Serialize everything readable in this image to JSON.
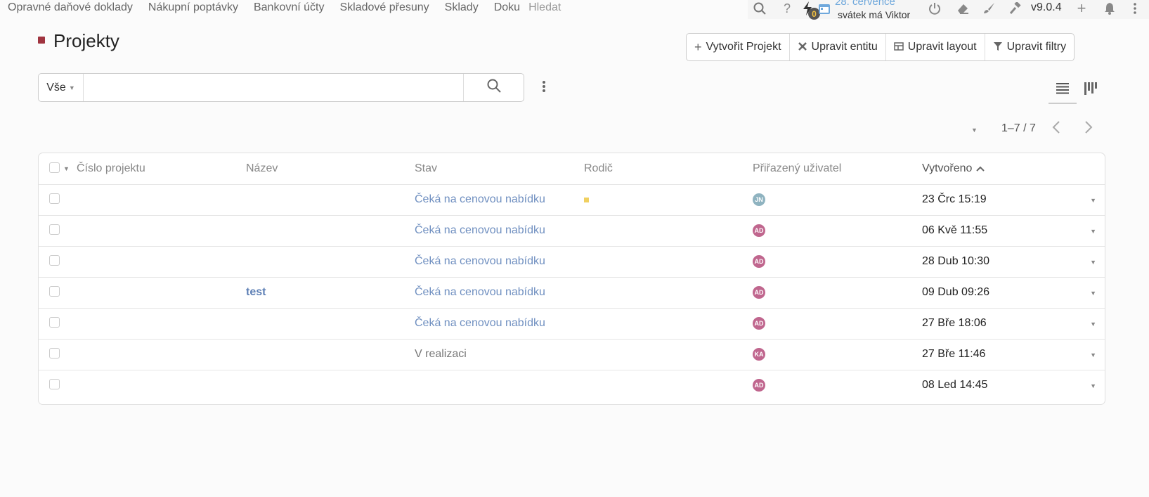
{
  "nav": {
    "links": [
      "Opravné daňové doklady",
      "Nákupní poptávky",
      "Bankovní účty",
      "Skladové přesuny",
      "Sklady",
      "Doku"
    ],
    "search_placeholder": "Hledat",
    "notification_count": "0",
    "date": "28. července",
    "holiday": "svátek má Viktor",
    "version": "v9.0.4"
  },
  "page": {
    "title": "Projekty",
    "accent_color": "#a0343f"
  },
  "actions": {
    "create": "Vytvořit Projekt",
    "edit_entity": "Upravit entitu",
    "edit_layout": "Upravit layout",
    "edit_filters": "Upravit filtry"
  },
  "search": {
    "scope": "Vše",
    "value": ""
  },
  "pagination": {
    "range": "1–7 / 7"
  },
  "table": {
    "headers": {
      "number": "Číslo projektu",
      "name": "Název",
      "status": "Stav",
      "parent": "Rodič",
      "assigned": "Přiřazený uživatel",
      "created": "Vytvořeno"
    },
    "rows": [
      {
        "name": "",
        "status": "Čeká na cenovou nabídku",
        "avatar": "JN",
        "avatar_color": "#8fb3c0",
        "created": "23 Črc 15:19"
      },
      {
        "name": "",
        "status": "Čeká na cenovou nabídku",
        "avatar": "AD",
        "avatar_color": "#c0668e",
        "created": "06 Kvě 11:55"
      },
      {
        "name": "",
        "status": "Čeká na cenovou nabídku",
        "avatar": "AD",
        "avatar_color": "#c0668e",
        "created": "28 Dub 10:30"
      },
      {
        "name": "test",
        "status": "Čeká na cenovou nabídku",
        "avatar": "AD",
        "avatar_color": "#c0668e",
        "created": "09 Dub 09:26"
      },
      {
        "name": "",
        "status": "Čeká na cenovou nabídku",
        "avatar": "AD",
        "avatar_color": "#c0668e",
        "created": "27 Bře 18:06"
      },
      {
        "name": "",
        "status": "V realizaci",
        "avatar": "KA",
        "avatar_color": "#c0668e",
        "created": "27 Bře 11:46"
      },
      {
        "name": "",
        "status": "",
        "avatar": "AD",
        "avatar_color": "#c0668e",
        "created": "08 Led 14:45"
      }
    ]
  }
}
